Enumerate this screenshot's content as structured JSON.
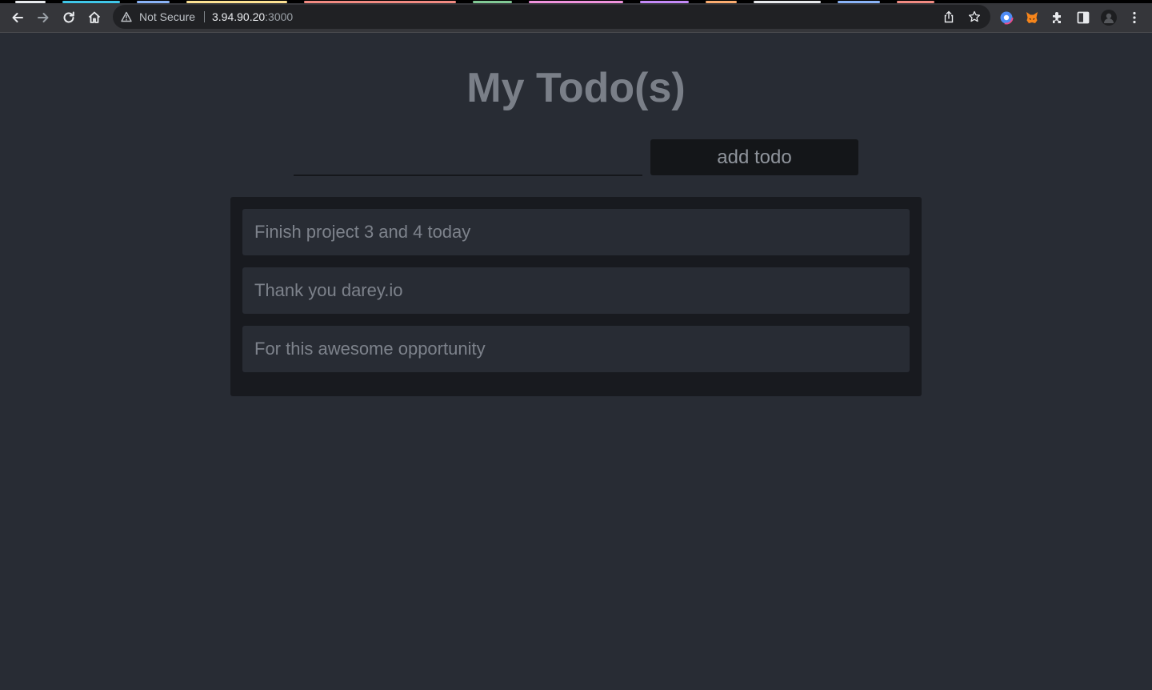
{
  "browser": {
    "security_label": "Not Secure",
    "url_host": "3.94.90.20",
    "url_port": ":3000",
    "tab_colors": [
      "#e8eaed",
      "#3fc7e9",
      "#8ab4f8",
      "#fde293",
      "#f28b82",
      "#81c995",
      "#f093dd",
      "#c58af9",
      "#fcad70",
      "#e8eaed",
      "#8ab4f8",
      "#f28b82"
    ],
    "icons": {
      "back": "arrow-left-icon",
      "forward": "arrow-right-icon",
      "reload": "reload-icon",
      "home": "home-icon",
      "warning": "warning-triangle-icon",
      "share": "share-icon",
      "bookmark": "star-icon",
      "extension_1": "circle-logo-icon",
      "extension_2": "fox-icon",
      "extensions": "puzzle-icon",
      "side_panel": "side-panel-icon",
      "profile": "avatar-icon",
      "menu": "kebab-menu-icon"
    }
  },
  "app": {
    "title": "My Todo(s)",
    "input": {
      "value": "",
      "placeholder": ""
    },
    "add_button_label": "add todo",
    "todos": [
      {
        "text": "Finish project 3 and 4 today"
      },
      {
        "text": "Thank you darey.io"
      },
      {
        "text": "For this awesome opportunity"
      }
    ]
  },
  "colors": {
    "page_background": "#282c34",
    "panel_background": "#181a1f",
    "item_background": "#282c34",
    "title_text": "#7a7f88",
    "button_background": "#141619"
  }
}
